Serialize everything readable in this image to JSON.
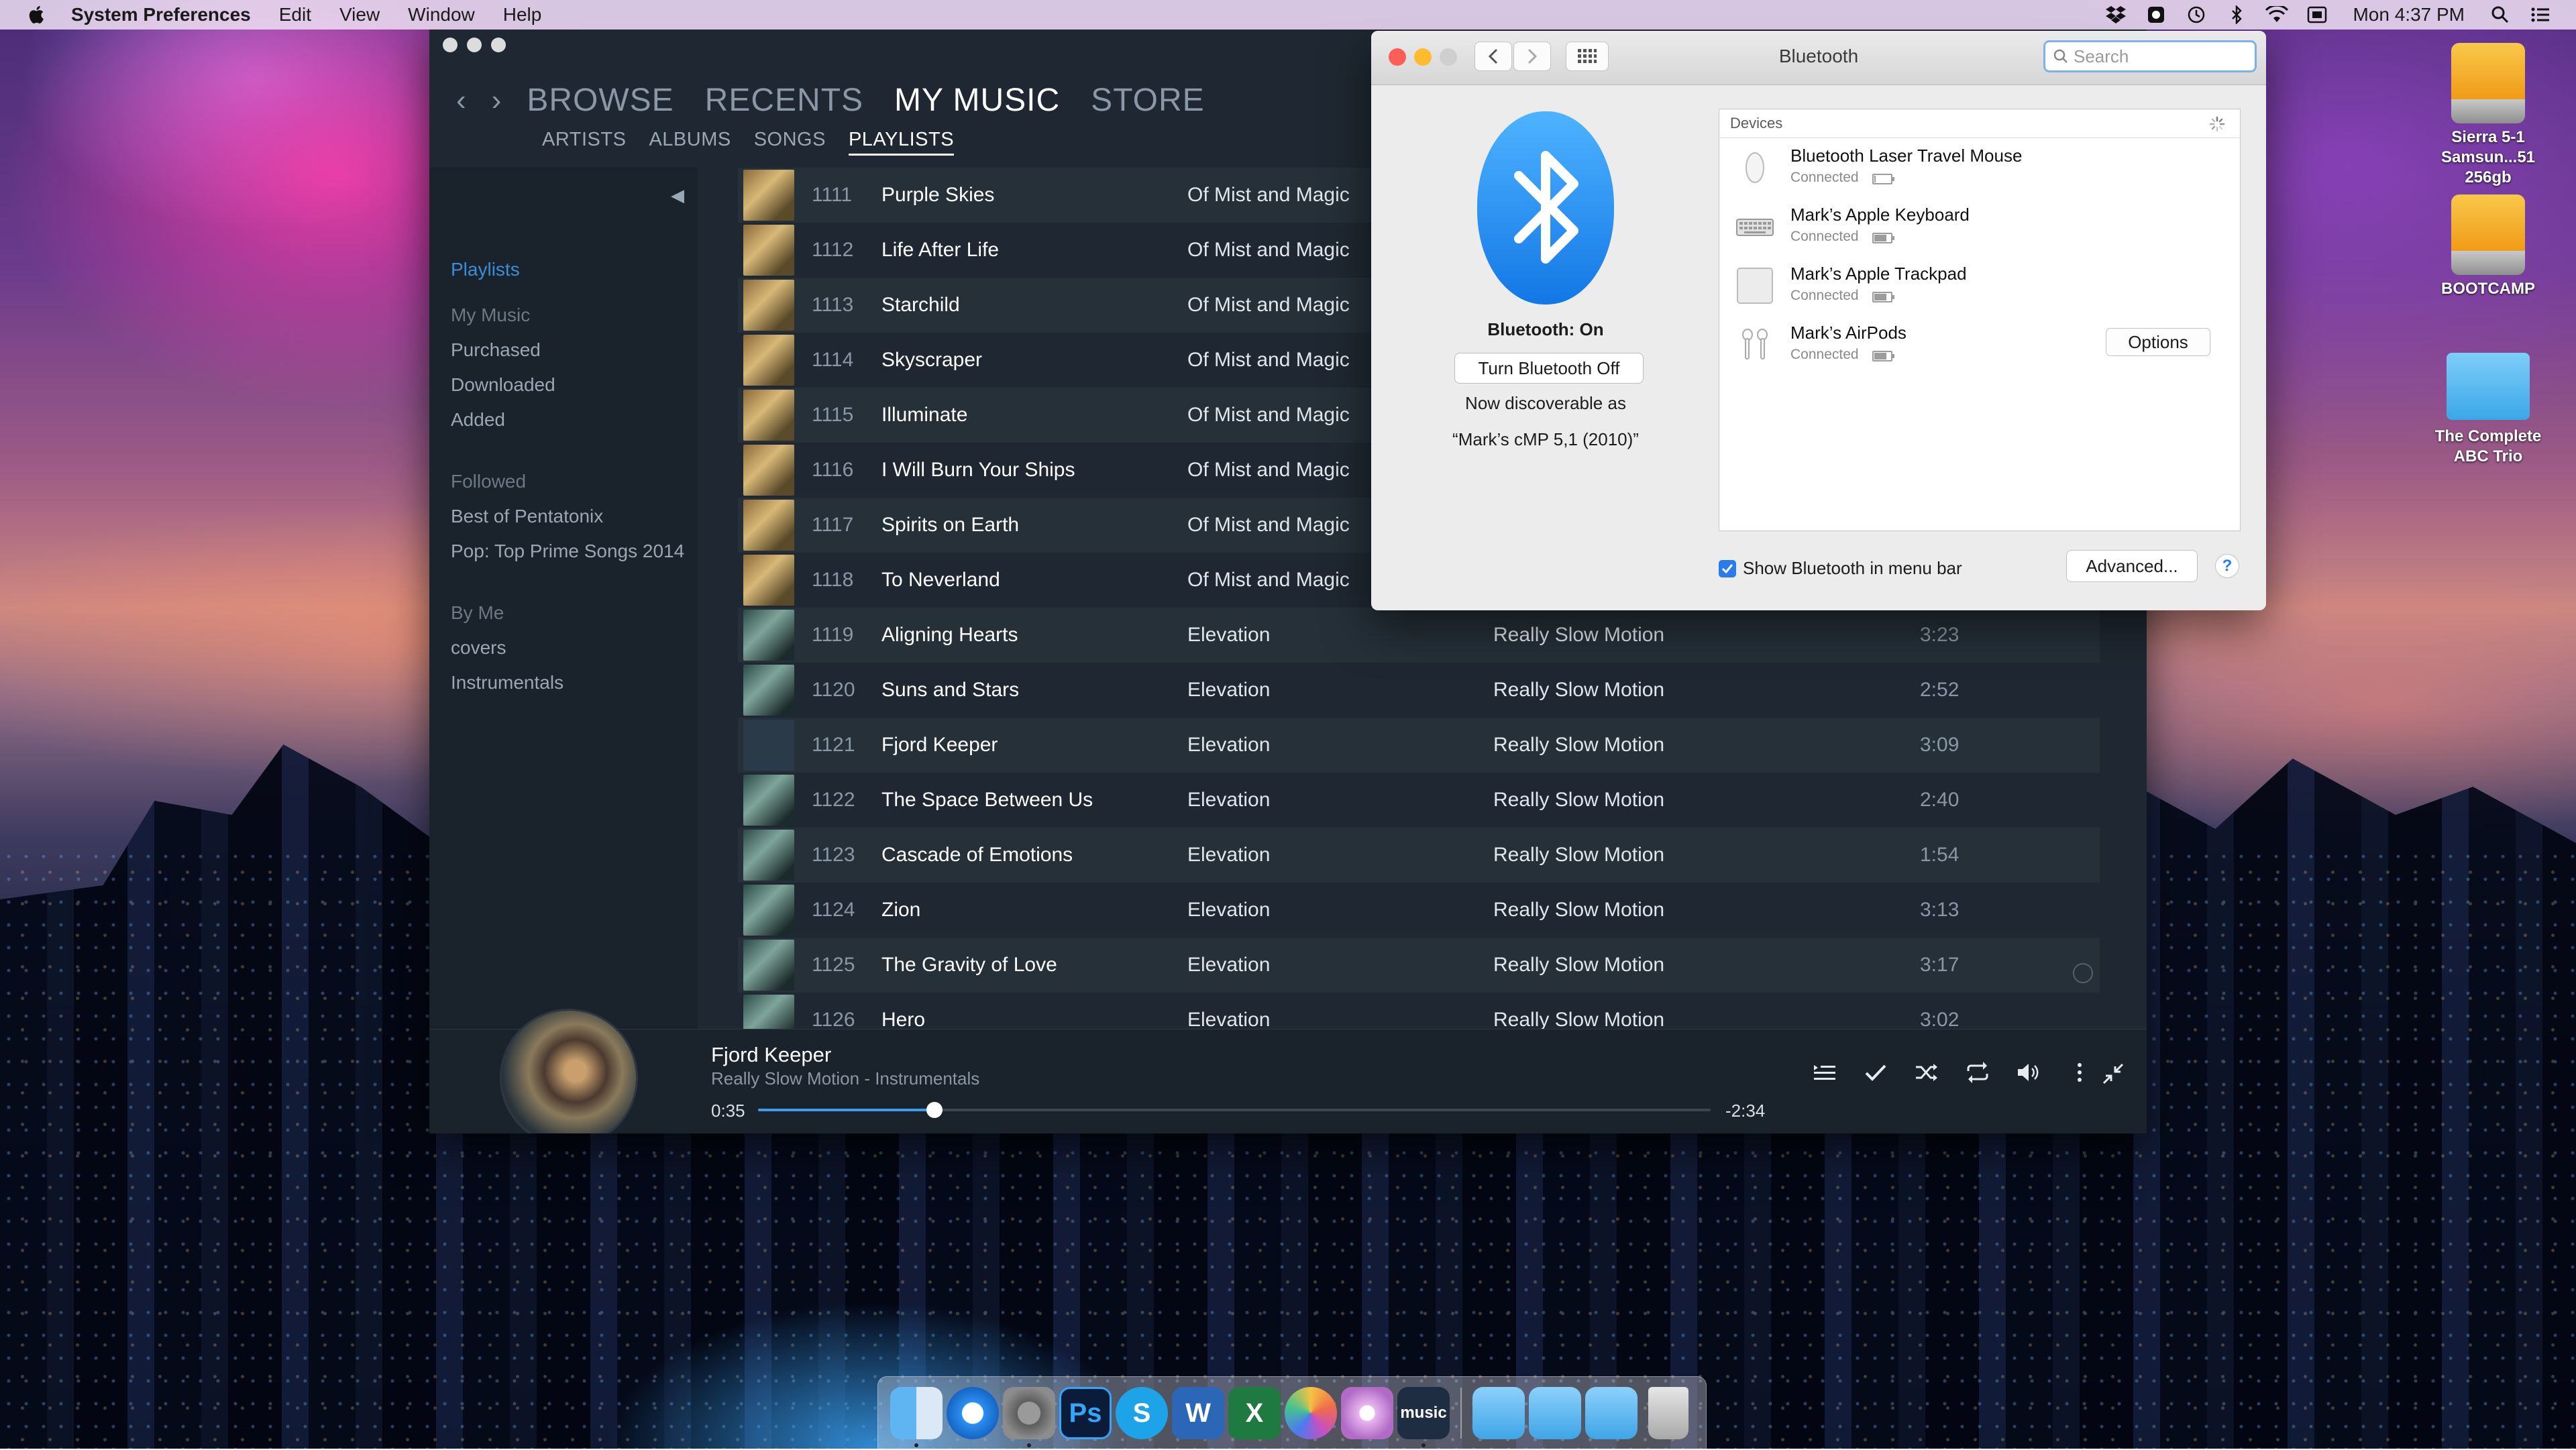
{
  "menubar": {
    "app_name": "System Preferences",
    "menus": [
      "Edit",
      "View",
      "Window",
      "Help"
    ],
    "clock": "Mon 4:37 PM"
  },
  "music": {
    "top_tabs": [
      "BROWSE",
      "RECENTS",
      "MY MUSIC",
      "STORE"
    ],
    "active_top_tab": "MY MUSIC",
    "sub_tabs": [
      "ARTISTS",
      "ALBUMS",
      "SONGS",
      "PLAYLISTS"
    ],
    "active_sub_tab": "PLAYLISTS",
    "sidebar": {
      "playlists_heading": "Playlists",
      "my_music_heading": "My Music",
      "my_music_items": [
        "Purchased",
        "Downloaded",
        "Added"
      ],
      "followed_heading": "Followed",
      "followed_items": [
        "Best of Pentatonix",
        "Pop: Top Prime Songs 2014"
      ],
      "by_me_heading": "By Me",
      "by_me_items": [
        "covers",
        "Instrumentals"
      ]
    },
    "tracks": [
      {
        "num": "1111",
        "title": "Purple Skies",
        "artist": "Of Mist and Magic",
        "album": "",
        "duration": "",
        "art": "mist"
      },
      {
        "num": "1112",
        "title": "Life After Life",
        "artist": "Of Mist and Magic",
        "album": "",
        "duration": "",
        "art": "mist"
      },
      {
        "num": "1113",
        "title": "Starchild",
        "artist": "Of Mist and Magic",
        "album": "",
        "duration": "",
        "art": "mist"
      },
      {
        "num": "1114",
        "title": "Skyscraper",
        "artist": "Of Mist and Magic",
        "album": "",
        "duration": "",
        "art": "mist"
      },
      {
        "num": "1115",
        "title": "Illuminate",
        "artist": "Of Mist and Magic",
        "album": "",
        "duration": "",
        "art": "mist"
      },
      {
        "num": "1116",
        "title": "I Will Burn Your Ships",
        "artist": "Of Mist and Magic",
        "album": "",
        "duration": "",
        "art": "mist"
      },
      {
        "num": "1117",
        "title": "Spirits on Earth",
        "artist": "Of Mist and Magic",
        "album": "",
        "duration": "",
        "art": "mist"
      },
      {
        "num": "1118",
        "title": "To Neverland",
        "artist": "Of Mist and Magic",
        "album": "",
        "duration": "",
        "art": "mist"
      },
      {
        "num": "1119",
        "title": "Aligning Hearts",
        "artist": "Elevation",
        "album": "Really Slow Motion",
        "duration": "3:23",
        "art": "elev"
      },
      {
        "num": "1120",
        "title": "Suns and Stars",
        "artist": "Elevation",
        "album": "Really Slow Motion",
        "duration": "2:52",
        "art": "elev"
      },
      {
        "num": "1121",
        "title": "Fjord Keeper",
        "artist": "Elevation",
        "album": "Really Slow Motion",
        "duration": "3:09",
        "art": "eq"
      },
      {
        "num": "1122",
        "title": "The Space Between Us",
        "artist": "Elevation",
        "album": "Really Slow Motion",
        "duration": "2:40",
        "art": "elev"
      },
      {
        "num": "1123",
        "title": "Cascade of Emotions",
        "artist": "Elevation",
        "album": "Really Slow Motion",
        "duration": "1:54",
        "art": "elev"
      },
      {
        "num": "1124",
        "title": "Zion",
        "artist": "Elevation",
        "album": "Really Slow Motion",
        "duration": "3:13",
        "art": "elev"
      },
      {
        "num": "1125",
        "title": "The Gravity of Love",
        "artist": "Elevation",
        "album": "Really Slow Motion",
        "duration": "3:17",
        "art": "elev"
      },
      {
        "num": "1126",
        "title": "Hero",
        "artist": "Elevation",
        "album": "Really Slow Motion",
        "duration": "3:02",
        "art": "elev"
      }
    ],
    "now_playing": {
      "title": "Fjord Keeper",
      "subtitle": "Really Slow Motion - Instrumentals",
      "elapsed": "0:35",
      "remaining": "-2:34",
      "progress_fraction": 0.185
    }
  },
  "bluetooth": {
    "window_title": "Bluetooth",
    "search_placeholder": "Search",
    "status": "Bluetooth: On",
    "toggle_label": "Turn Bluetooth Off",
    "discoverable_line1": "Now discoverable as",
    "discoverable_line2": "“Mark’s cMP 5,1 (2010)”",
    "devices_heading": "Devices",
    "devices": [
      {
        "name": "Bluetooth Laser Travel Mouse",
        "status": "Connected",
        "icon": "mouse-icon",
        "battery": 0.1
      },
      {
        "name": "Mark’s Apple Keyboard",
        "status": "Connected",
        "icon": "keyboard-icon",
        "battery": 0.8
      },
      {
        "name": "Mark’s Apple Trackpad",
        "status": "Connected",
        "icon": "trackpad-icon",
        "battery": 0.8
      },
      {
        "name": "Mark’s AirPods",
        "status": "Connected",
        "icon": "airpods-icon",
        "battery": 0.8,
        "options": "Options"
      }
    ],
    "show_in_menubar_label": "Show Bluetooth in menu bar",
    "show_in_menubar_checked": true,
    "advanced_label": "Advanced...",
    "help_label": "?"
  },
  "desktop_icons": [
    {
      "label": "Sierra 5-1 Samsun...51 256gb",
      "type": "drive"
    },
    {
      "label": "BOOTCAMP",
      "type": "drive"
    },
    {
      "label": "The Complete ABC Trio",
      "type": "folder"
    }
  ],
  "dock": {
    "apps": [
      "finder-icon",
      "safari-icon",
      "system-preferences-icon",
      "photoshop-icon",
      "skype-icon",
      "word-icon",
      "excel-icon",
      "photos-icon",
      "flower-app-icon",
      "amazon-music-icon"
    ],
    "music_label": "music",
    "folders": [
      "applications-folder-icon",
      "documents-folder-icon",
      "downloads-folder-icon"
    ],
    "trash": "trash-icon"
  },
  "colors": {
    "music_bg": "#1f2832",
    "music_accent": "#3a8ed8",
    "bluetooth_blue": "#1d8bf1",
    "close_red": "#fc5f57",
    "minimize_yellow": "#fdbc2e"
  }
}
